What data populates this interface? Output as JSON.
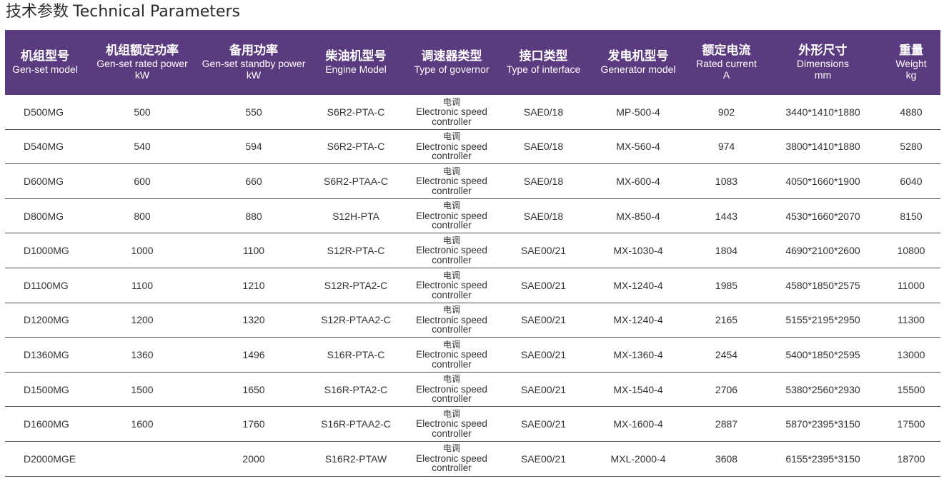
{
  "page": {
    "title_cn": "技术参数",
    "title_en": "Technical Parameters"
  },
  "colors": {
    "header_bg": "#5b3b80",
    "header_text": "#ffffff",
    "row_border": "#4a4a4a"
  },
  "columns": [
    {
      "cn": "机组型号",
      "en": "Gen-set model",
      "unit": ""
    },
    {
      "cn": "机组额定功率",
      "en": "Gen-set rated power",
      "unit": "kW"
    },
    {
      "cn": "备用功率",
      "en": "Gen-set standby power",
      "unit": "kW"
    },
    {
      "cn": "柴油机型号",
      "en": "Engine Model",
      "unit": ""
    },
    {
      "cn": "调速器类型",
      "en": "Type of governor",
      "unit": ""
    },
    {
      "cn": "接口类型",
      "en": "Type of interface",
      "unit": ""
    },
    {
      "cn": "发电机型号",
      "en": "Generator model",
      "unit": ""
    },
    {
      "cn": "额定电流",
      "en": "Rated current",
      "unit": "A"
    },
    {
      "cn": "外形尺寸",
      "en": "Dimensions",
      "unit": "mm"
    },
    {
      "cn": "重量",
      "en": "Weight",
      "unit": "kg"
    }
  ],
  "rows": [
    {
      "model": "D500MG",
      "rated": "500",
      "standby": "550",
      "engine": "S6R2-PTA-C",
      "gov_cn": "电调",
      "gov_en1": "Electronic speed",
      "gov_en2": "controller",
      "iface": "SAE0/18",
      "gen": "MP-500-4",
      "current": "902",
      "dim": "3440*1410*1880",
      "weight": "4880"
    },
    {
      "model": "D540MG",
      "rated": "540",
      "standby": "594",
      "engine": "S6R2-PTA-C",
      "gov_cn": "电调",
      "gov_en1": "Electronic speed",
      "gov_en2": "controller",
      "iface": "SAE0/18",
      "gen": "MX-560-4",
      "current": "974",
      "dim": "3800*1410*1880",
      "weight": "5280"
    },
    {
      "model": "D600MG",
      "rated": "600",
      "standby": "660",
      "engine": "S6R2-PTAA-C",
      "gov_cn": "电调",
      "gov_en1": "Electronic speed",
      "gov_en2": "controller",
      "iface": "SAE0/18",
      "gen": "MX-600-4",
      "current": "1083",
      "dim": "4050*1660*1900",
      "weight": "6040"
    },
    {
      "model": "D800MG",
      "rated": "800",
      "standby": "880",
      "engine": "S12H-PTA",
      "gov_cn": "电调",
      "gov_en1": "Electronic speed",
      "gov_en2": "controller",
      "iface": "SAE0/18",
      "gen": "MX-850-4",
      "current": "1443",
      "dim": "4530*1660*2070",
      "weight": "8150"
    },
    {
      "model": "D1000MG",
      "rated": "1000",
      "standby": "1100",
      "engine": "S12R-PTA-C",
      "gov_cn": "电调",
      "gov_en1": "Electronic speed",
      "gov_en2": "controller",
      "iface": "SAE00/21",
      "gen": "MX-1030-4",
      "current": "1804",
      "dim": "4690*2100*2600",
      "weight": "10800"
    },
    {
      "model": "D1100MG",
      "rated": "1100",
      "standby": "1210",
      "engine": "S12R-PTA2-C",
      "gov_cn": "电调",
      "gov_en1": "Electronic speed",
      "gov_en2": "controller",
      "iface": "SAE00/21",
      "gen": "MX-1240-4",
      "current": "1985",
      "dim": "4580*1850*2575",
      "weight": "11000"
    },
    {
      "model": "D1200MG",
      "rated": "1200",
      "standby": "1320",
      "engine": "S12R-PTAA2-C",
      "gov_cn": "电调",
      "gov_en1": "Electronic speed",
      "gov_en2": "controller",
      "iface": "SAE00/21",
      "gen": "MX-1240-4",
      "current": "2165",
      "dim": "5155*2195*2950",
      "weight": "11300"
    },
    {
      "model": "D1360MG",
      "rated": "1360",
      "standby": "1496",
      "engine": "S16R-PTA-C",
      "gov_cn": "电调",
      "gov_en1": "Electronic speed",
      "gov_en2": "controller",
      "iface": "SAE00/21",
      "gen": "MX-1360-4",
      "current": "2454",
      "dim": "5400*1850*2595",
      "weight": "13000"
    },
    {
      "model": "D1500MG",
      "rated": "1500",
      "standby": "1650",
      "engine": "S16R-PTA2-C",
      "gov_cn": "电调",
      "gov_en1": "Electronic speed",
      "gov_en2": "controller",
      "iface": "SAE00/21",
      "gen": "MX-1540-4",
      "current": "2706",
      "dim": "5380*2560*2930",
      "weight": "15500"
    },
    {
      "model": "D1600MG",
      "rated": "1600",
      "standby": "1760",
      "engine": "S16R-PTAA2-C",
      "gov_cn": "电调",
      "gov_en1": "Electronic speed",
      "gov_en2": "controller",
      "iface": "SAE00/21",
      "gen": "MX-1600-4",
      "current": "2887",
      "dim": "5870*2395*3150",
      "weight": "17500"
    },
    {
      "model": "D2000MGE",
      "rated": "",
      "standby": "2000",
      "engine": "S16R2-PTAW",
      "gov_cn": "电调",
      "gov_en1": "Electronic speed",
      "gov_en2": "controller",
      "iface": "SAE00/21",
      "gen": "MXL-2000-4",
      "current": "3608",
      "dim": "6155*2395*3150",
      "weight": "18700"
    }
  ]
}
